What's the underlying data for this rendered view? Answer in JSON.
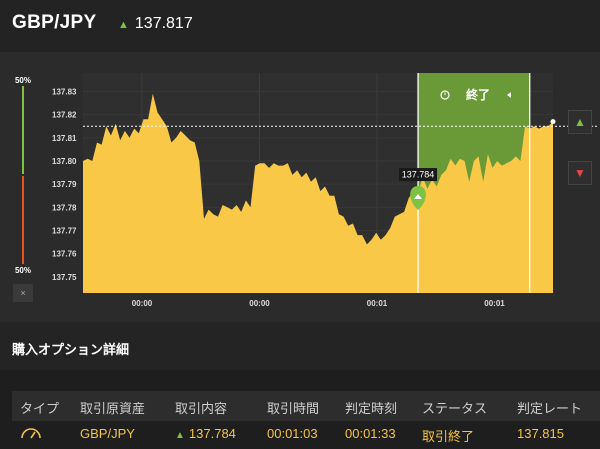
{
  "header": {
    "pair": "GBP/JPY",
    "price": "137.817",
    "price_direction": "up"
  },
  "gauge": {
    "top_label": "50%",
    "bottom_label": "50%",
    "close_label": "×"
  },
  "chart_data": {
    "type": "area",
    "y_ticks": [
      "137.83",
      "137.82",
      "137.81",
      "137.80",
      "137.79",
      "137.78",
      "137.77",
      "137.76",
      "137.75"
    ],
    "x_ticks": [
      "00:00",
      "00:00",
      "00:01",
      "00:01"
    ],
    "ylim": [
      137.743,
      137.838
    ],
    "current_rate_line": 137.815,
    "entry_marker": {
      "label": "137.784",
      "value": 137.784,
      "direction": "up"
    },
    "option_window_label": "終了",
    "series": [
      {
        "values": [
          137.8,
          137.801,
          137.8,
          137.808,
          137.807,
          137.815,
          137.811,
          137.816,
          137.809,
          137.813,
          137.81,
          137.814,
          137.812,
          137.818,
          137.818,
          137.829,
          137.821,
          137.818,
          137.815,
          137.808,
          137.81,
          137.813,
          137.811,
          137.809,
          137.808,
          137.8,
          137.775,
          137.779,
          137.777,
          137.776,
          137.781,
          137.78,
          137.779,
          137.781,
          137.778,
          137.783,
          137.78,
          137.798,
          137.799,
          137.799,
          137.797,
          137.799,
          137.798,
          137.798,
          137.799,
          137.794,
          137.796,
          137.793,
          137.795,
          137.791,
          137.793,
          137.787,
          137.789,
          137.785,
          137.785,
          137.777,
          137.776,
          137.772,
          137.773,
          137.768,
          137.768,
          137.764,
          137.766,
          137.769,
          137.766,
          137.768,
          137.771,
          137.776,
          137.777,
          137.778,
          137.784,
          137.787,
          137.786,
          137.793,
          137.788,
          137.792,
          137.789,
          137.794,
          137.796,
          137.801,
          137.798,
          137.801,
          137.8,
          137.791,
          137.8,
          137.802,
          137.791,
          137.803,
          137.797,
          137.8,
          137.798,
          137.799,
          137.8,
          137.802,
          137.8,
          137.815,
          137.814,
          137.815,
          137.814,
          137.815,
          137.815,
          137.817
        ]
      }
    ]
  },
  "details": {
    "title": "購入オプション詳細",
    "columns": [
      "タイプ",
      "取引原資産",
      "取引内容",
      "取引時間",
      "判定時刻",
      "ステータス",
      "判定レート"
    ],
    "row": {
      "type_icon": "gauge-icon",
      "asset": "GBP/JPY",
      "content": "137.784",
      "content_direction": "up",
      "time": "00:01:03",
      "judge_time": "00:01:33",
      "status": "取引終了",
      "rate": "137.815"
    }
  },
  "colors": {
    "area_fill": "#f9c846",
    "window_fill": "#6a9a38",
    "call": "#7dc242",
    "put": "#e84545",
    "table_value": "#f5c542"
  }
}
